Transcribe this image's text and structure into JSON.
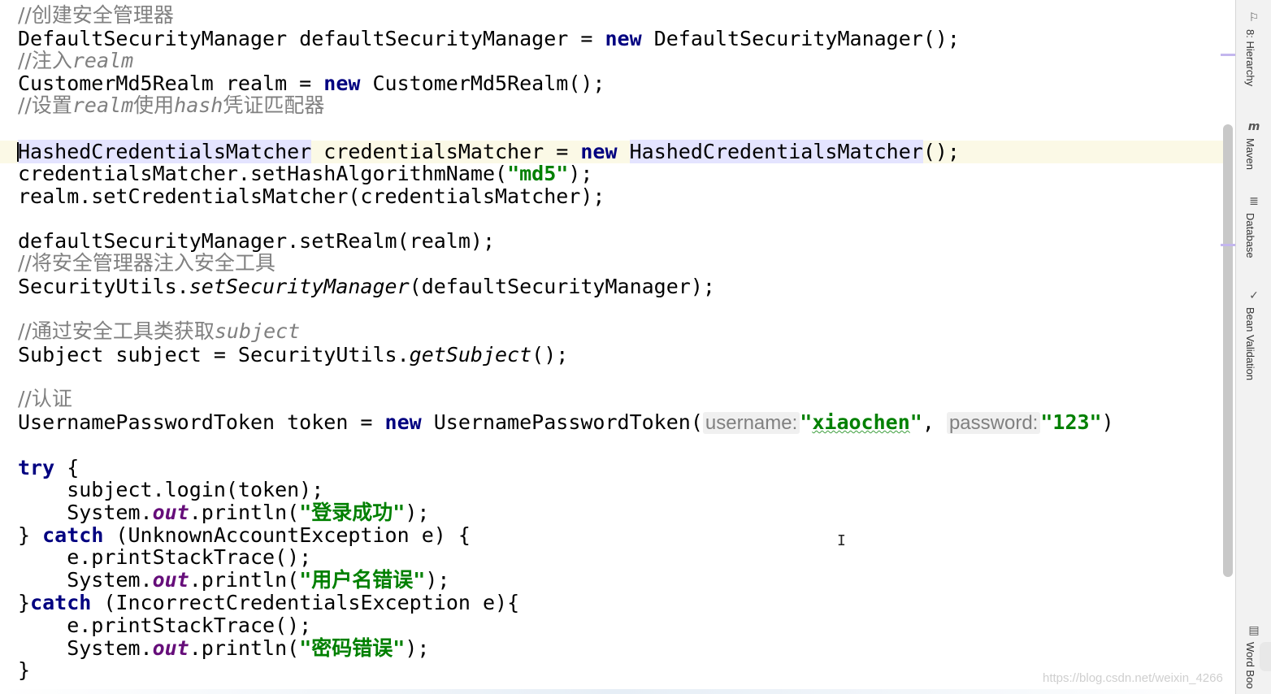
{
  "code": {
    "c1": "//创建安全管理器",
    "l2_type": "DefaultSecurityManager",
    "l2_rest": " defaultSecurityManager = ",
    "kw_new": "new",
    "l2_ctor": " DefaultSecurityManager();",
    "c3a": "//注入",
    "c3b": "realm",
    "l4_a": "CustomerMd5Realm realm = ",
    "l4_b": " CustomerMd5Realm();",
    "c5a": "//设置",
    "c5b": "realm",
    "c5c": "使用",
    "c5d": "hash",
    "c5e": "凭证匹配器",
    "l7_type": "HashedCredentialsMatcher",
    "l7_mid": " credentialsMatcher = ",
    "l7_ctor": "HashedCredentialsMatcher",
    "l7_end": "();",
    "l8_a": "credentialsMatcher.setHashAlgorithmName(",
    "l8_str": "\"md5\"",
    "l8_b": ");",
    "l9": "realm.setCredentialsMatcher(credentialsMatcher);",
    "l11": "defaultSecurityManager.setRealm(realm);",
    "c12": "//将安全管理器注入安全工具",
    "l13_a": "SecurityUtils.",
    "l13_m": "setSecurityManager",
    "l13_b": "(defaultSecurityManager);",
    "c15a": "//通过安全工具类获取",
    "c15b": "subject",
    "l16_a": "Subject subject = SecurityUtils.",
    "l16_m": "getSubject",
    "l16_b": "();",
    "c18": "//认证",
    "l19_a": "UsernamePasswordToken token = ",
    "l19_b": " UsernamePasswordToken(",
    "hint_user": "username:",
    "str_q": "\"",
    "user_val": "xiaochen",
    "comma": ",",
    "hint_pass": "password:",
    "pass_val": "\"123\"",
    "close": ")",
    "kw_try": "try",
    "brace_open": " {",
    "l22": "    subject.login(token);",
    "sys": "    System.",
    "out": "out",
    "println": ".println(",
    "s_login_ok": "\"登录成功\"",
    "end": ");",
    "l24_a": "} ",
    "kw_catch": "catch",
    "l24_b": " (UnknownAccountException e) {",
    "l25": "    e.printStackTrace();",
    "s_user_err": "\"用户名错误\"",
    "l27_a": "}",
    "l27_b": " (IncorrectCredentialsException e){",
    "s_pwd_err": "\"密码错误\"",
    "l30": "}"
  },
  "sidebar": {
    "tools": [
      {
        "label": "8: Hierarchy",
        "icon": "hierarchy-icon",
        "glyph": "⚐"
      },
      {
        "label": "Maven",
        "icon": "maven-icon",
        "glyph": "m"
      },
      {
        "label": "Database",
        "icon": "database-icon",
        "glyph": "≣"
      },
      {
        "label": "Bean Validation",
        "icon": "bean-validation-icon",
        "glyph": "✓"
      },
      {
        "label": "Word Boo",
        "icon": "book-icon",
        "glyph": "▤"
      }
    ]
  },
  "watermark": "https://blog.csdn.net/weixin_4266",
  "cursor_glyph": "I"
}
